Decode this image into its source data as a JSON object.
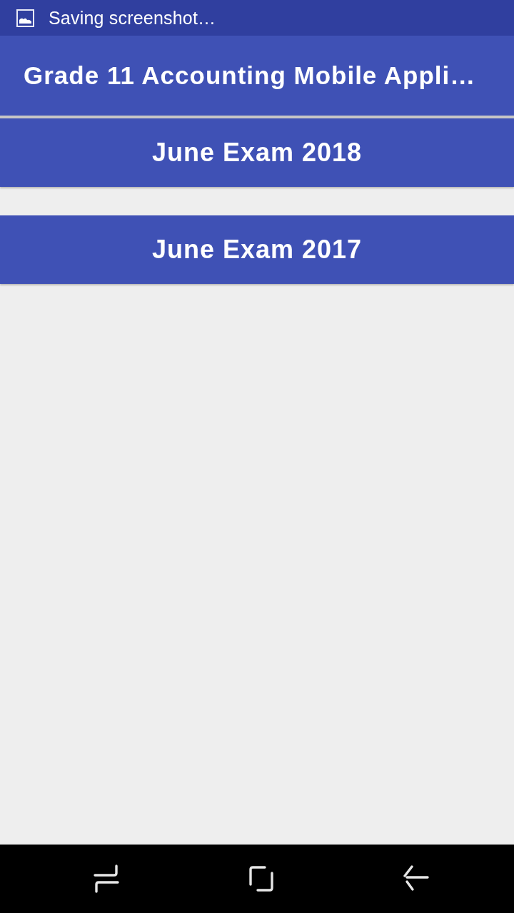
{
  "status_bar": {
    "notification": "Saving screenshot…"
  },
  "app_bar": {
    "title": "Grade 11 Accounting Mobile Appli…"
  },
  "exams": [
    {
      "label": "June Exam 2018"
    },
    {
      "label": "June Exam 2017"
    }
  ],
  "nav_bar": {
    "buttons": [
      {
        "kind": "recents"
      },
      {
        "kind": "home"
      },
      {
        "kind": "back"
      }
    ]
  }
}
